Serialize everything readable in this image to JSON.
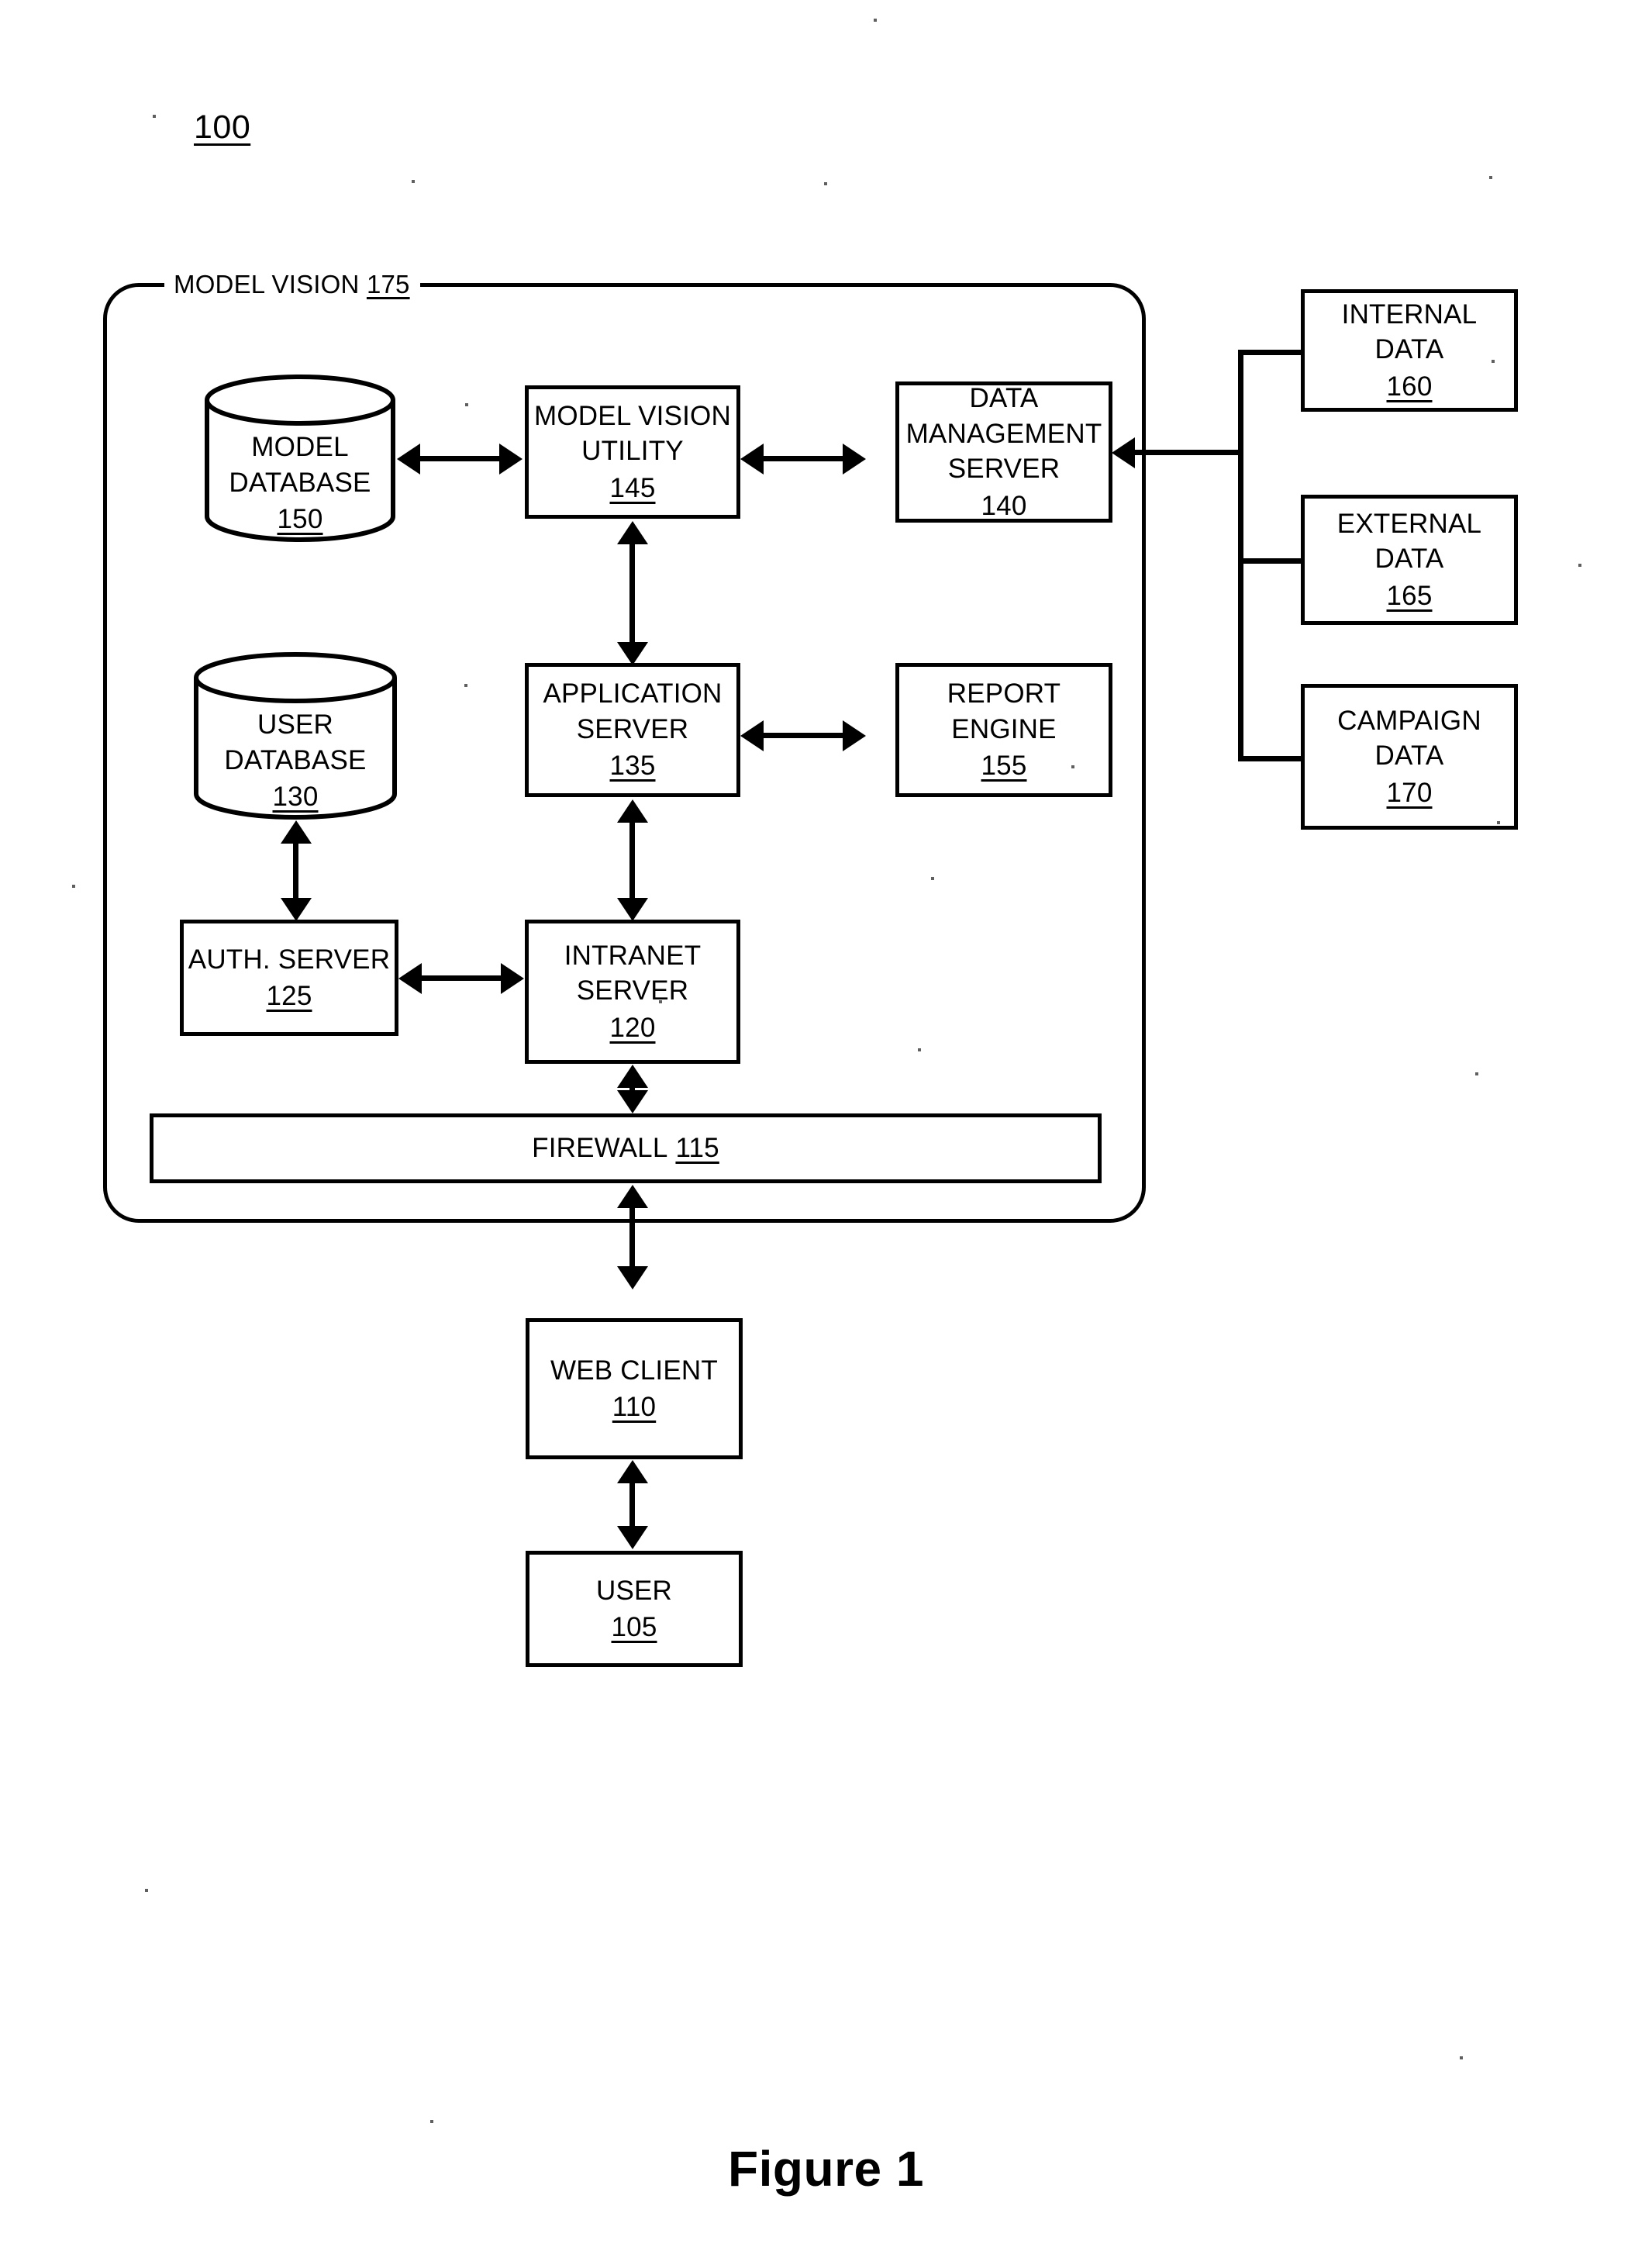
{
  "figure": {
    "caption": "Figure 1",
    "system_reference": "100"
  },
  "system_boundary": {
    "label": "MODEL VISION",
    "refnum": "175"
  },
  "nodes": {
    "model_database": {
      "line1": "MODEL",
      "line2": "DATABASE",
      "refnum": "150",
      "shape": "cylinder"
    },
    "model_vision_utility": {
      "line1": "MODEL VISION",
      "line2": "UTILITY",
      "refnum": "145",
      "shape": "rect"
    },
    "data_management_server": {
      "line1": "DATA",
      "line2": "MANAGEMENT",
      "line3": "SERVER",
      "refnum": "140",
      "shape": "rect"
    },
    "user_database": {
      "line1": "USER",
      "line2": "DATABASE",
      "refnum": "130",
      "shape": "cylinder"
    },
    "application_server": {
      "line1": "APPLICATION",
      "line2": "SERVER",
      "refnum": "135",
      "shape": "rect"
    },
    "report_engine": {
      "line1": "REPORT",
      "line2": "ENGINE",
      "refnum": "155",
      "shape": "rect"
    },
    "auth_server": {
      "line1": "AUTH. SERVER",
      "refnum": "125",
      "shape": "rect"
    },
    "intranet_server": {
      "line1": "INTRANET",
      "line2": "SERVER",
      "refnum": "120",
      "shape": "rect"
    },
    "firewall": {
      "line1": "FIREWALL",
      "refnum": "115",
      "shape": "bar"
    },
    "web_client": {
      "line1": "WEB CLIENT",
      "refnum": "110",
      "shape": "rect"
    },
    "user": {
      "line1": "USER",
      "refnum": "105",
      "shape": "rect"
    },
    "internal_data": {
      "line1": "INTERNAL",
      "line2": "DATA",
      "refnum": "160",
      "shape": "rect"
    },
    "external_data": {
      "line1": "EXTERNAL",
      "line2": "DATA",
      "refnum": "165",
      "shape": "rect"
    },
    "campaign_data": {
      "line1": "CAMPAIGN",
      "line2": "DATA",
      "refnum": "170",
      "shape": "rect"
    }
  },
  "connections": [
    {
      "from": "model_database",
      "to": "model_vision_utility",
      "direction": "bidirectional"
    },
    {
      "from": "model_vision_utility",
      "to": "data_management_server",
      "direction": "bidirectional"
    },
    {
      "from": "model_vision_utility",
      "to": "application_server",
      "direction": "bidirectional"
    },
    {
      "from": "application_server",
      "to": "report_engine",
      "direction": "bidirectional"
    },
    {
      "from": "application_server",
      "to": "intranet_server",
      "direction": "bidirectional"
    },
    {
      "from": "user_database",
      "to": "auth_server",
      "direction": "bidirectional"
    },
    {
      "from": "auth_server",
      "to": "intranet_server",
      "direction": "bidirectional"
    },
    {
      "from": "intranet_server",
      "to": "firewall",
      "direction": "bidirectional"
    },
    {
      "from": "firewall",
      "to": "web_client",
      "direction": "bidirectional"
    },
    {
      "from": "web_client",
      "to": "user",
      "direction": "bidirectional"
    },
    {
      "from": "data_management_server",
      "to": "internal_data",
      "direction": "from-trunk"
    },
    {
      "from": "data_management_server",
      "to": "external_data",
      "direction": "from-trunk"
    },
    {
      "from": "data_management_server",
      "to": "campaign_data",
      "direction": "from-trunk"
    }
  ],
  "colors": {
    "ink": "#000000",
    "paper": "#ffffff"
  }
}
